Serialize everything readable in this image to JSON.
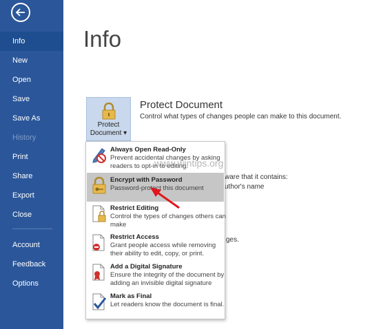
{
  "sidebar": {
    "items": [
      {
        "label": "Info"
      },
      {
        "label": "New"
      },
      {
        "label": "Open"
      },
      {
        "label": "Save"
      },
      {
        "label": "Save As"
      },
      {
        "label": "History"
      },
      {
        "label": "Print"
      },
      {
        "label": "Share"
      },
      {
        "label": "Export"
      },
      {
        "label": "Close"
      },
      {
        "label": "Account"
      },
      {
        "label": "Feedback"
      },
      {
        "label": "Options"
      }
    ]
  },
  "main": {
    "title": "Info",
    "protect_button": {
      "line1": "Protect",
      "line2": "Document ▾"
    },
    "protect_title": "Protect Document",
    "protect_desc": "Control what types of changes people can make to this document.",
    "bg_text_1": "ware that it contains:",
    "bg_text_2": "uthor's name",
    "bg_text_3": "ges."
  },
  "menu": {
    "items": [
      {
        "title": "Always Open Read-Only",
        "desc": "Prevent accidental changes by asking readers to opt-in to editing."
      },
      {
        "title": "Encrypt with Password",
        "desc": "Password-protect this document"
      },
      {
        "title": "Restrict Editing",
        "desc": "Control the types of changes others can make"
      },
      {
        "title": "Restrict Access",
        "desc": "Grant people access while removing their ability to edit, copy, or print."
      },
      {
        "title": "Add a Digital Signature",
        "desc": "Ensure the integrity of the document by adding an invisible digital signature"
      },
      {
        "title": "Mark as Final",
        "desc": "Let readers know the document is final."
      }
    ]
  },
  "watermark": "www.wintips.org",
  "colors": {
    "sidebar": "#2b579a",
    "sidebar_active": "#1e4e8f",
    "menu_highlight": "#c6c6c6",
    "arrow": "#e0161b"
  }
}
